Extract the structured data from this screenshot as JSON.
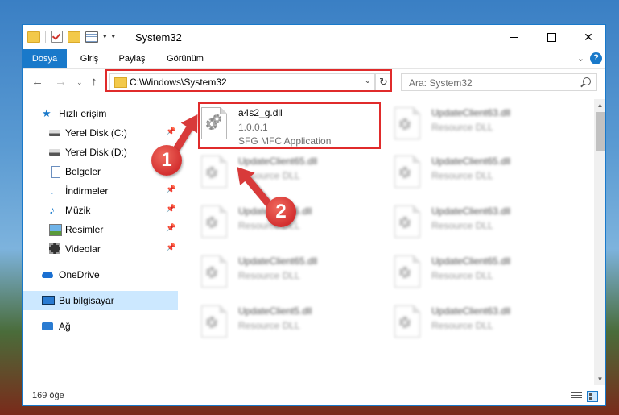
{
  "window": {
    "title": "System32",
    "controls": {
      "minimize": "",
      "maximize": "",
      "close": "✕"
    }
  },
  "ribbon": {
    "tabs": [
      {
        "label": "Dosya"
      },
      {
        "label": "Giriş"
      },
      {
        "label": "Paylaş"
      },
      {
        "label": "Görünüm"
      }
    ],
    "help": "?",
    "chevron": "⌄"
  },
  "nav": {
    "back": "←",
    "forward": "→",
    "recent": "⌄",
    "up": "↑",
    "address": "C:\\Windows\\System32",
    "address_dropdown": "⌄",
    "refresh": "↻",
    "search_placeholder": "Ara: System32"
  },
  "sidebar": {
    "items": [
      {
        "label": "Hızlı erişim",
        "icon": "star-icon",
        "pinned": false
      },
      {
        "label": "Yerel Disk (C:)",
        "icon": "drive-icon",
        "pinned": true
      },
      {
        "label": "Yerel Disk (D:)",
        "icon": "drive-icon",
        "pinned": true
      },
      {
        "label": "Belgeler",
        "icon": "documents-icon",
        "pinned": true
      },
      {
        "label": "İndirmeler",
        "icon": "download-icon",
        "pinned": true
      },
      {
        "label": "Müzik",
        "icon": "music-icon",
        "pinned": true
      },
      {
        "label": "Resimler",
        "icon": "pictures-icon",
        "pinned": true
      },
      {
        "label": "Videolar",
        "icon": "videos-icon",
        "pinned": true
      },
      {
        "label": "OneDrive",
        "icon": "cloud-icon",
        "pinned": false
      },
      {
        "label": "Bu bilgisayar",
        "icon": "computer-icon",
        "pinned": false,
        "selected": true
      },
      {
        "label": "Ağ",
        "icon": "network-icon",
        "pinned": false
      }
    ],
    "pin_glyph": "📌"
  },
  "files": [
    {
      "name": "a4s2_g.dll",
      "version": "1.0.0.1",
      "desc": "SFG MFC Application"
    },
    {
      "name": "UpdateClient63.dll",
      "desc": "Resource DLL"
    },
    {
      "name": "UpdateClient65.dll",
      "desc": "Resource DLL"
    },
    {
      "name": "UpdateClient65.dll",
      "desc": "Resource DLL"
    },
    {
      "name": "UpdateClient5.dll",
      "desc": "Resource DLL"
    },
    {
      "name": "UpdateClient63.dll",
      "desc": "Resource DLL"
    },
    {
      "name": "UpdateClient65.dll",
      "desc": "Resource DLL"
    },
    {
      "name": "UpdateClient65.dll",
      "desc": "Resource DLL"
    },
    {
      "name": "UpdateClient5.dll",
      "desc": "Resource DLL"
    },
    {
      "name": "UpdateClient63.dll",
      "desc": "Resource DLL"
    }
  ],
  "status": {
    "count": "169 öğe"
  },
  "annotations": {
    "badge1": "1",
    "badge2": "2"
  },
  "colors": {
    "accent": "#1979ca",
    "highlight": "#e02b2b",
    "selection": "#cce8ff"
  }
}
